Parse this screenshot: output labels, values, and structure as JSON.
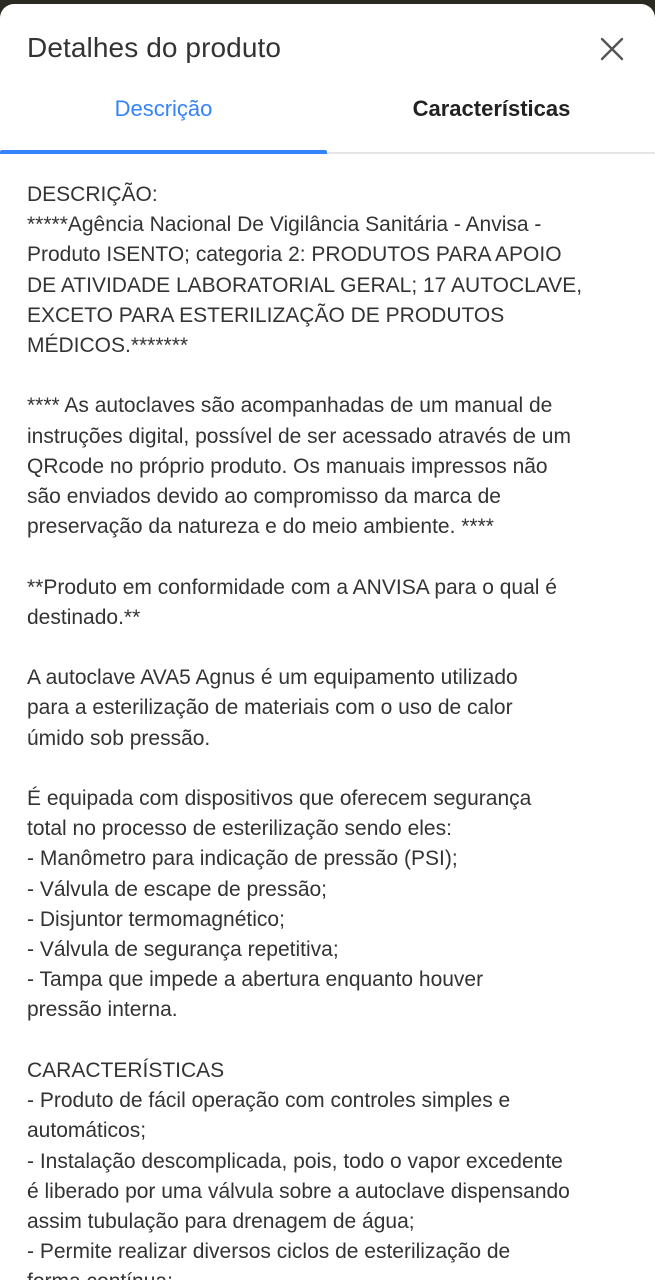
{
  "header": {
    "title": "Detalhes do produto",
    "close_icon": "close-icon"
  },
  "tabs": [
    {
      "label": "Descrição",
      "active": true
    },
    {
      "label": "Características",
      "active": false
    }
  ],
  "colors": {
    "accent": "#3483fa",
    "text": "#333333",
    "divider": "#e6e6e6"
  },
  "description": {
    "text": "DESCRIÇÃO:\n*****Agência Nacional De Vigilância Sanitária - Anvisa -\nProduto ISENTO; categoria 2: PRODUTOS PARA APOIO\nDE ATIVIDADE LABORATORIAL GERAL; 17 AUTOCLAVE,\nEXCETO PARA ESTERILIZAÇÃO DE PRODUTOS\nMÉDICOS.*******\n\n**** As autoclaves são acompanhadas de um manual de\ninstruções digital, possível de ser acessado através de um\nQRcode no próprio produto. Os manuais impressos não\nsão enviados devido ao compromisso da marca de\npreservação da natureza e do meio ambiente. ****\n\n**Produto em conformidade com a ANVISA para o qual é\ndestinado.**\n\nA autoclave AVA5 Agnus é um equipamento utilizado\npara a esterilização de materiais com o uso de calor\númido sob pressão.\n\nÉ equipada com dispositivos que oferecem segurança\ntotal no processo de esterilização sendo eles:\n- Manômetro para indicação de pressão (PSI);\n- Válvula de escape de pressão;\n- Disjuntor termomagnético;\n- Válvula de segurança repetitiva;\n- Tampa que impede a abertura enquanto houver\npressão interna.\n\nCARACTERÍSTICAS\n- Produto de fácil operação com controles simples e\nautomáticos;\n- Instalação descomplicada, pois, todo o vapor excedente\né liberado por uma válvula sobre a autoclave dispensando\nassim tubulação para drenagem de água;\n- Permite realizar diversos ciclos de esterilização de\nforma contínua;"
  }
}
